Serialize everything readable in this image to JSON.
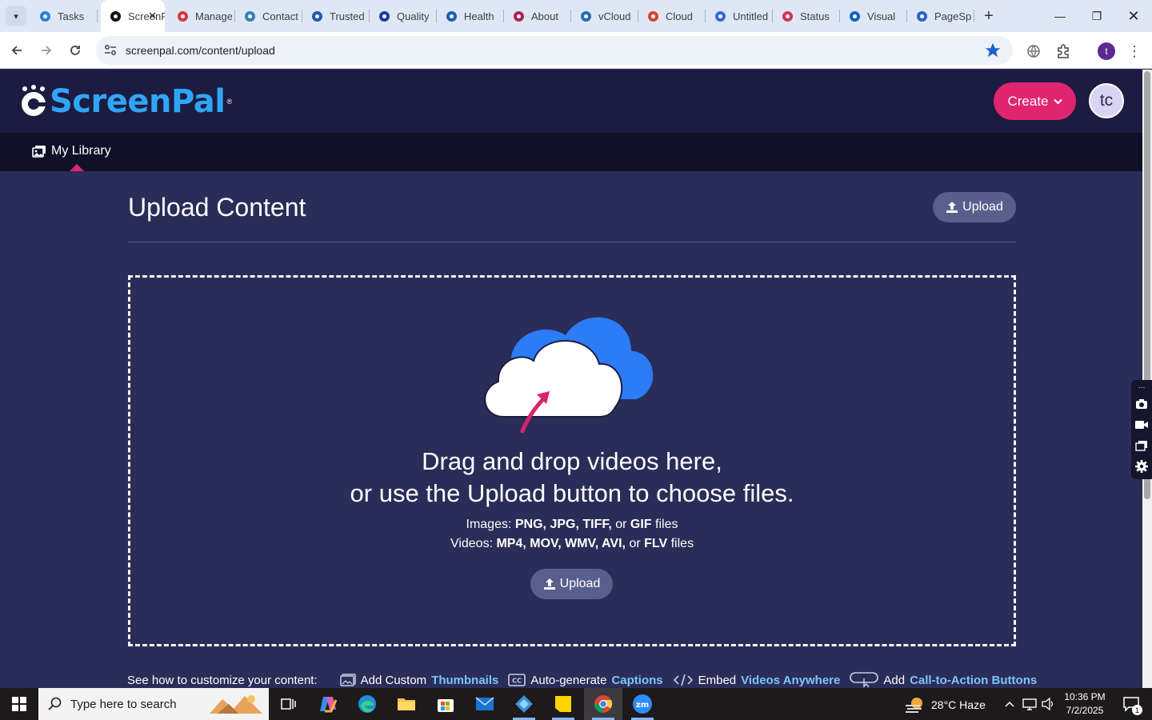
{
  "browser": {
    "tabs": [
      {
        "title": "Tasks",
        "icon": "tasks-icon",
        "color": "#2f7fd8"
      },
      {
        "title": "ScreenPal",
        "icon": "screenpal-icon",
        "color": "#111111",
        "active": true
      },
      {
        "title": "Manage",
        "icon": "manage-icon",
        "color": "#d93737"
      },
      {
        "title": "Contact",
        "icon": "contact-icon",
        "color": "#2e86a9"
      },
      {
        "title": "Trusted",
        "icon": "scales-icon",
        "color": "#1e5aa8"
      },
      {
        "title": "Quality",
        "icon": "x-icon",
        "color": "#1f3a93"
      },
      {
        "title": "Health",
        "icon": "check-icon",
        "color": "#1a5fb4"
      },
      {
        "title": "About",
        "icon": "about-icon",
        "color": "#b0234f"
      },
      {
        "title": "vCloud",
        "icon": "vcloud-icon",
        "color": "#2b6cb0"
      },
      {
        "title": "Cloud",
        "icon": "cloud-icon",
        "color": "#d1462f"
      },
      {
        "title": "Untitled",
        "icon": "docs-icon",
        "color": "#2f6fd1"
      },
      {
        "title": "Status",
        "icon": "status-icon",
        "color": "#d4345a"
      },
      {
        "title": "Visual",
        "icon": "visual-icon",
        "color": "#1565c0"
      },
      {
        "title": "PageSp",
        "icon": "pagespeed-icon",
        "color": "#2b63c8"
      }
    ],
    "url": "screenpal.com/content/upload"
  },
  "header": {
    "logo_text": "ScreenPal",
    "create_label": "Create",
    "avatar_initials": "tc"
  },
  "subnav": {
    "my_library_label": "My Library"
  },
  "main": {
    "title": "Upload Content",
    "upload_label": "Upload",
    "drop_line1": "Drag and drop videos here,",
    "drop_line2": "or use the Upload button to choose files.",
    "images_prefix": "Images:",
    "images_formats": "PNG, JPG, TIFF,",
    "images_or": "or",
    "images_last": "GIF",
    "images_suffix": "files",
    "videos_prefix": "Videos:",
    "videos_formats": "MP4, MOV, WMV, AVI,",
    "videos_or": "or",
    "videos_last": "FLV",
    "videos_suffix": "files",
    "upload_center_label": "Upload"
  },
  "features": {
    "intro": "See how to customize your content:",
    "items": [
      {
        "plain": "Add Custom",
        "bold": "Thumbnails",
        "icon": "thumbnail-icon"
      },
      {
        "plain": "Auto-generate",
        "bold": "Captions",
        "icon": "cc-icon"
      },
      {
        "plain": "Embed",
        "bold": "Videos Anywhere",
        "icon": "code-icon"
      },
      {
        "plain": "Add",
        "bold": "Call-to-Action Buttons",
        "icon": "cta-icon"
      }
    ]
  },
  "taskbar": {
    "search_placeholder": "Type here to search",
    "weather": "28°C  Haze",
    "time": "10:36 PM",
    "date": "7/2/2025",
    "notification_count": "1"
  },
  "colors": {
    "page_bg": "#2a2d57",
    "header_bg": "#1c1c42",
    "accent_pink": "#e0246f",
    "logo_blue": "#2fa6f5"
  }
}
